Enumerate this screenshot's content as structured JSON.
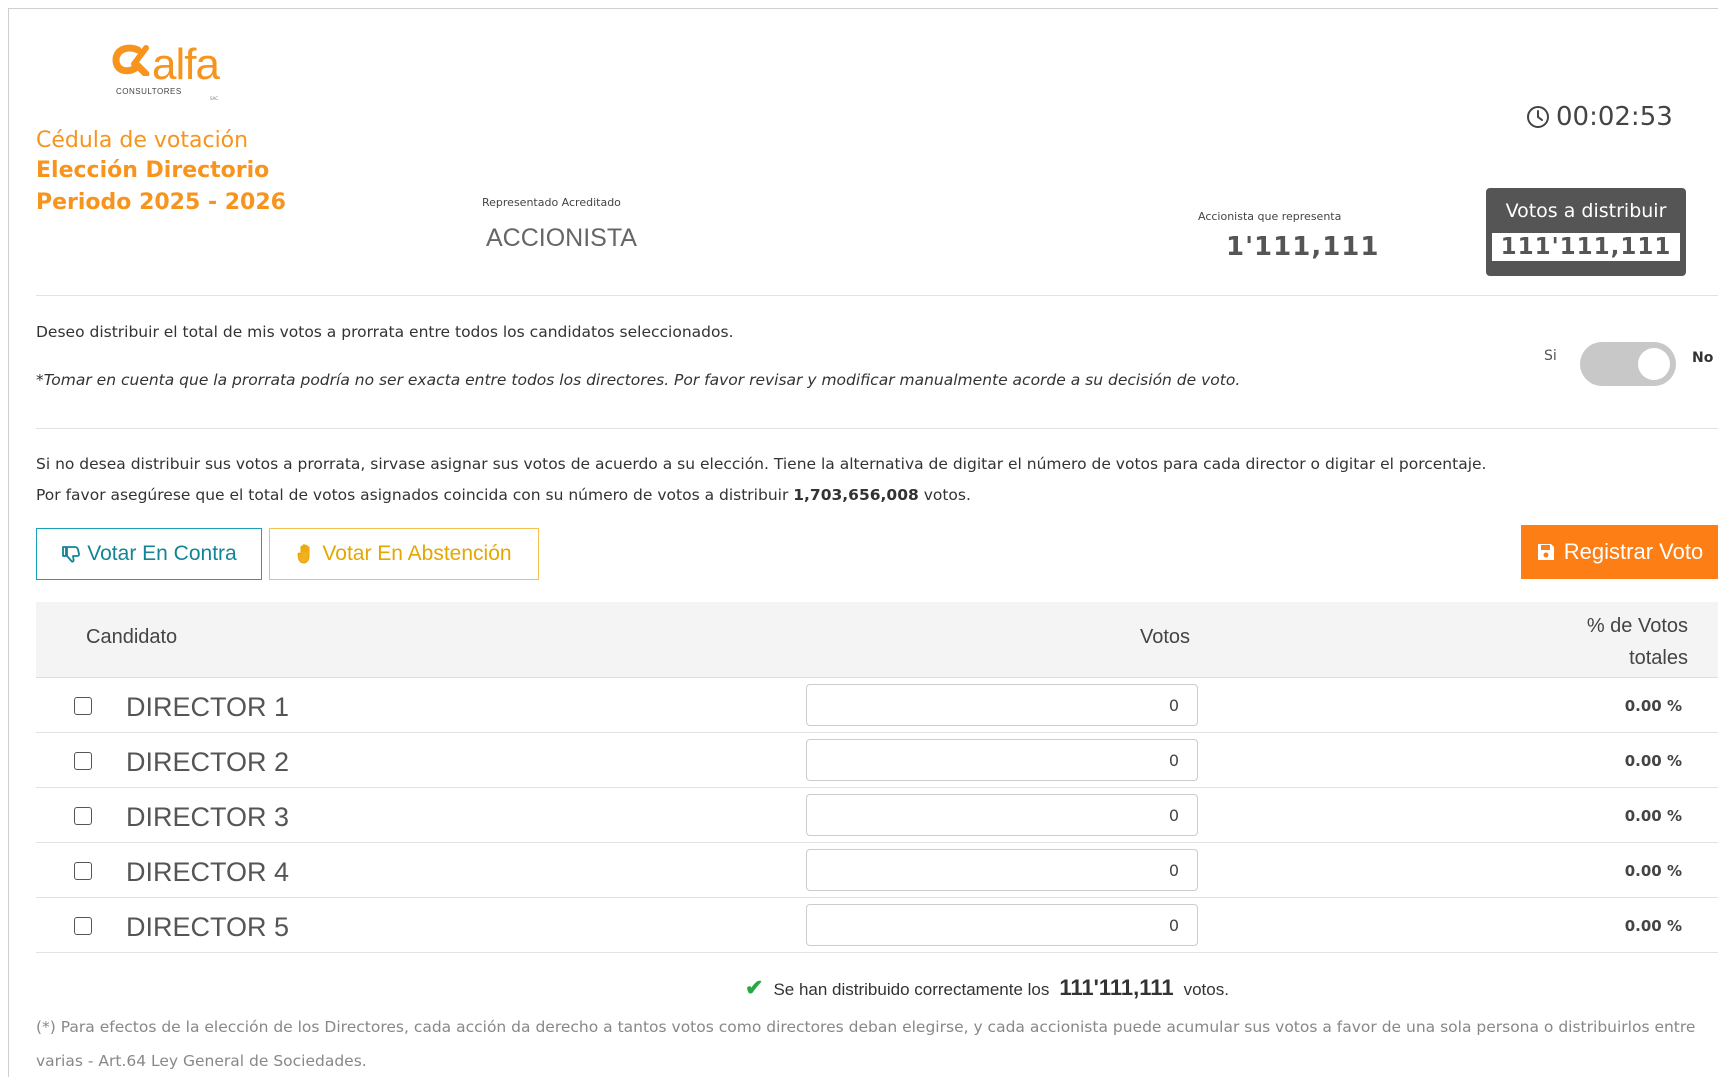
{
  "brand": {
    "logo_text": "alfa",
    "logo_subtitle": "CONSULTORES",
    "logo_suffix": "SAC"
  },
  "ballot": {
    "title": "Cédula de votación",
    "election": "Elección Directorio",
    "period": "Periodo 2025 - 2026"
  },
  "representative": {
    "label": "Representado Acreditado",
    "value": "ACCIONISTA"
  },
  "shareholder": {
    "label": "Accionista que representa",
    "value": "1'111,111"
  },
  "timer": {
    "value": "00:02:53",
    "icon": "clock-icon"
  },
  "votes_to_distribute": {
    "label": "Votos a distribuir",
    "value": "111'111,111"
  },
  "prorata": {
    "text": "Deseo distribuir el total de mis votos a prorrata entre todos los candidatos seleccionados.",
    "note": "*Tomar en cuenta que la prorrata podría no ser exacta entre todos los directores. Por favor revisar y modificar manualmente acorde a su decisión de voto.",
    "toggle_yes": "Si",
    "toggle_no": "No"
  },
  "instructions": {
    "line1": "Si no desea distribuir sus votos a prorrata, sirvase asignar sus votos de acuerdo a su elección. Tiene la alternativa de digitar el número de votos para cada director o digitar el porcentaje.",
    "line2_prefix": "Por favor asegúrese que el total de votos asignados coincida con su número de votos a distribuir ",
    "line2_number": "1,703,656,008",
    "line2_suffix": " votos."
  },
  "buttons": {
    "contra": "Votar En Contra",
    "abstencion": "Votar En Abstención",
    "registrar": "Registrar Voto"
  },
  "table": {
    "col_candidate": "Candidato",
    "col_votes": "Votos",
    "col_pct_line1": "% de Votos",
    "col_pct_line2": "totales",
    "rows": [
      {
        "name": "DIRECTOR 1",
        "votes": "0",
        "pct": "0.00 %"
      },
      {
        "name": "DIRECTOR 2",
        "votes": "0",
        "pct": "0.00 %"
      },
      {
        "name": "DIRECTOR 3",
        "votes": "0",
        "pct": "0.00 %"
      },
      {
        "name": "DIRECTOR 4",
        "votes": "0",
        "pct": "0.00 %"
      },
      {
        "name": "DIRECTOR 5",
        "votes": "0",
        "pct": "0.00 %"
      }
    ]
  },
  "success": {
    "prefix": "Se han distribuido correctamente los",
    "number": "111'111,111",
    "suffix": "votos."
  },
  "footnote": "(*) Para efectos de la elección de los Directores, cada acción da derecho a tantos votos como directores deban elegirse, y cada accionista puede acumular sus votos a favor de una sola persona o distribuirlos entre varias - Art.64 Ley General de Sociedades.",
  "colors": {
    "brand_orange": "#f7941d",
    "register_button": "#fd7e14",
    "contra_border": "#17a2b8",
    "abstention_border": "#f2c14e",
    "success_check": "#28a745",
    "votes_box_bg": "#555555"
  }
}
